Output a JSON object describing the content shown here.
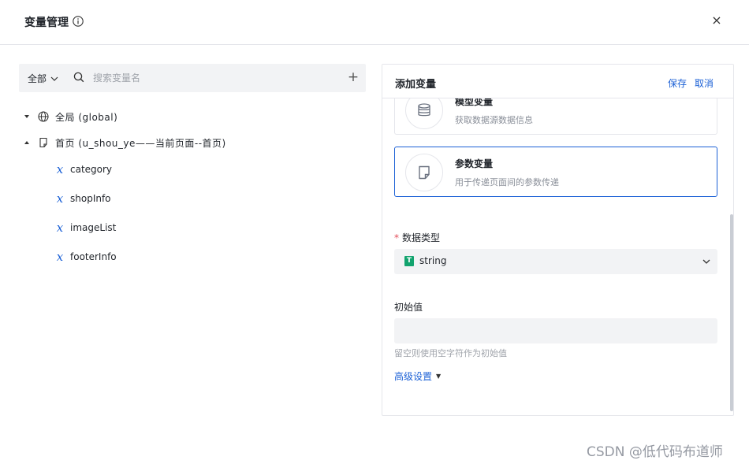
{
  "header": {
    "title": "变量管理",
    "close_label": "×"
  },
  "toolbar": {
    "filter_label": "全部",
    "search_placeholder": "搜索变量名",
    "add_label": "+"
  },
  "tree": {
    "global_label": "全局 (global)",
    "page_label": "首页 (u_shou_ye——当前页面--首页)",
    "variables": [
      "category",
      "shopInfo",
      "imageList",
      "footerInfo"
    ],
    "var_icon_glyph": "x"
  },
  "panel": {
    "title": "添加变量",
    "save_label": "保存",
    "cancel_label": "取消",
    "cards": [
      {
        "title": "模型变量",
        "desc": "获取数据源数据信息",
        "icon": "database-icon",
        "selected": false
      },
      {
        "title": "参数变量",
        "desc": "用于传递页面间的参数传递",
        "icon": "page-icon",
        "selected": true
      }
    ],
    "data_type": {
      "label": "数据类型",
      "required_mark": "*",
      "badge": "T",
      "value": "string"
    },
    "initial_value": {
      "label": "初始值",
      "value": "",
      "hint": "留空则使用空字符作为初始值"
    },
    "advanced_label": "高级设置"
  },
  "colors": {
    "accent": "#1c61d6",
    "type_badge": "#12a36e",
    "required": "#e34d59"
  },
  "watermark": "CSDN @低代码布道师"
}
